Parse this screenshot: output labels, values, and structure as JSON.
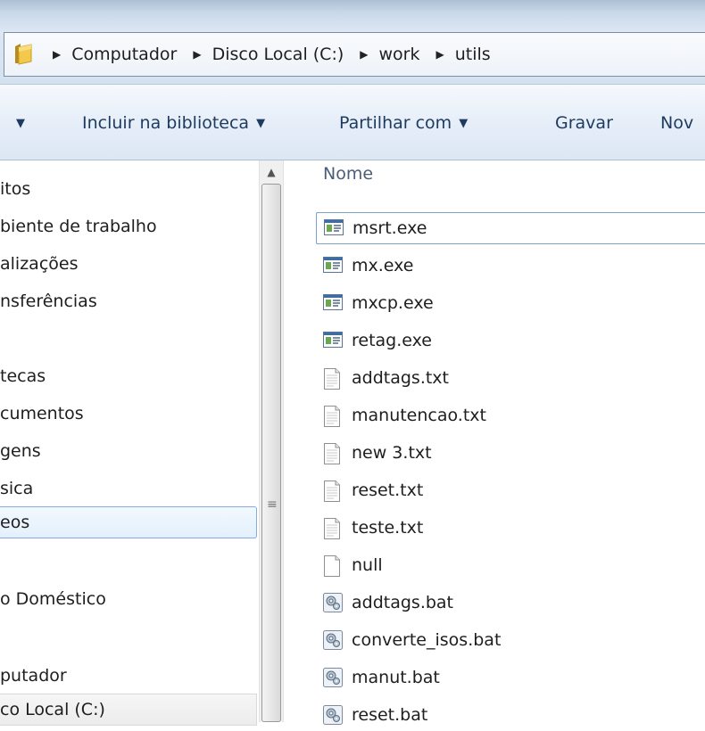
{
  "address_bar": {
    "path": [
      "Computador",
      "Disco Local (C:)",
      "work",
      "utils"
    ]
  },
  "toolbar": {
    "items": [
      {
        "label": "Incluir na biblioteca",
        "dropdown": true
      },
      {
        "label": "Partilhar com",
        "dropdown": true
      },
      {
        "label": "Gravar",
        "dropdown": false
      },
      {
        "label": "Nov",
        "dropdown": false
      }
    ]
  },
  "nav": {
    "items": [
      {
        "label": "itos"
      },
      {
        "label": "biente de trabalho"
      },
      {
        "label": "alizações"
      },
      {
        "label": "nsferências"
      },
      {
        "label": "tecas"
      },
      {
        "label": "cumentos"
      },
      {
        "label": "gens"
      },
      {
        "label": "sica"
      },
      {
        "label": "eos"
      },
      {
        "label": "o Doméstico"
      },
      {
        "label": "putador"
      },
      {
        "label": "co Local (C:)"
      }
    ]
  },
  "files": {
    "column_name": "Nome",
    "items": [
      {
        "name": "msrt.exe",
        "type": "exe"
      },
      {
        "name": "mx.exe",
        "type": "exe"
      },
      {
        "name": "mxcp.exe",
        "type": "exe"
      },
      {
        "name": "retag.exe",
        "type": "exe"
      },
      {
        "name": "addtags.txt",
        "type": "txt"
      },
      {
        "name": "manutencao.txt",
        "type": "txt"
      },
      {
        "name": "new  3.txt",
        "type": "txt"
      },
      {
        "name": "reset.txt",
        "type": "txt"
      },
      {
        "name": "teste.txt",
        "type": "txt"
      },
      {
        "name": "null",
        "type": "blank"
      },
      {
        "name": "addtags.bat",
        "type": "bat"
      },
      {
        "name": "converte_isos.bat",
        "type": "bat"
      },
      {
        "name": "manut.bat",
        "type": "bat"
      },
      {
        "name": "reset.bat",
        "type": "bat"
      }
    ]
  },
  "colors": {
    "selection_border": "#84acdd",
    "toolbar_text": "#1e3a5f"
  }
}
